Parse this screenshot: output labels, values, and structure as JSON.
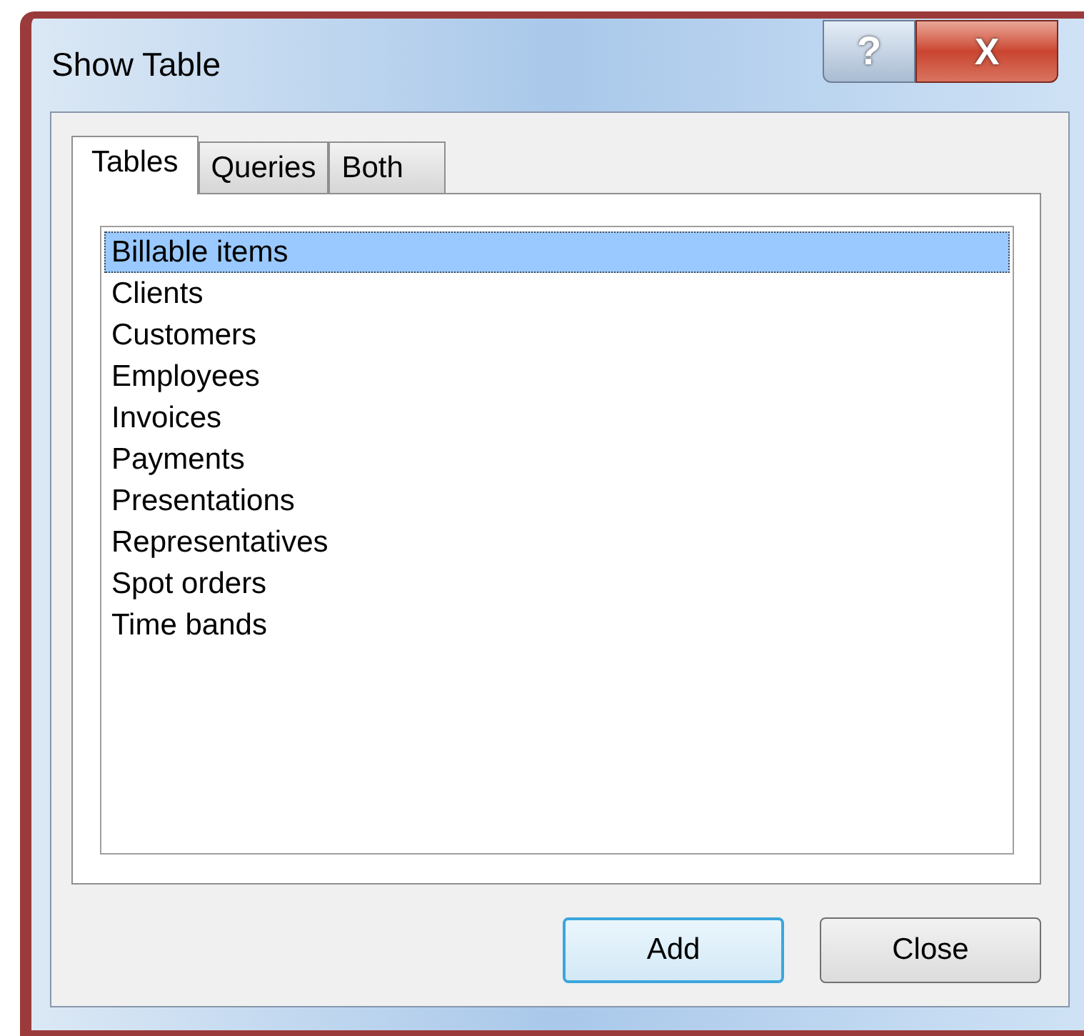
{
  "window": {
    "title": "Show Table",
    "help_button": "?",
    "close_button": "X"
  },
  "tabs": [
    {
      "label": "Tables",
      "selected": true
    },
    {
      "label": "Queries",
      "selected": false
    },
    {
      "label": "Both",
      "selected": false
    }
  ],
  "list": {
    "items": [
      {
        "label": "Billable items",
        "selected": true
      },
      {
        "label": "Clients",
        "selected": false
      },
      {
        "label": "Customers",
        "selected": false
      },
      {
        "label": "Employees",
        "selected": false
      },
      {
        "label": "Invoices",
        "selected": false
      },
      {
        "label": "Payments",
        "selected": false
      },
      {
        "label": "Presentations",
        "selected": false
      },
      {
        "label": "Representatives",
        "selected": false
      },
      {
        "label": "Spot orders",
        "selected": false
      },
      {
        "label": "Time bands",
        "selected": false
      }
    ]
  },
  "buttons": [
    {
      "label": "Add",
      "default": true
    },
    {
      "label": "Close",
      "default": false
    }
  ]
}
